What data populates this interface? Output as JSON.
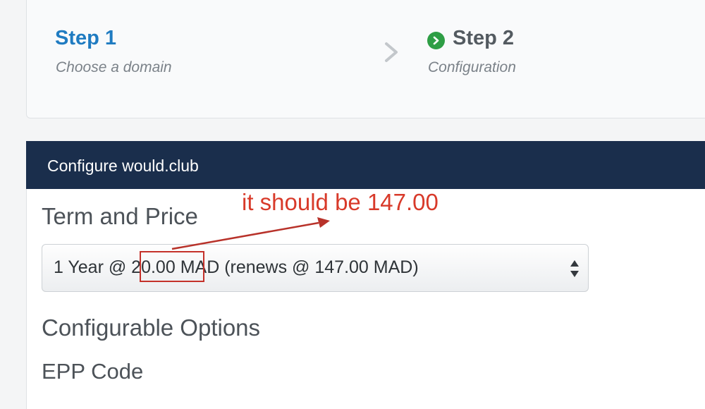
{
  "steps": [
    {
      "title": "Step 1",
      "subtitle": "Choose a domain"
    },
    {
      "title": "Step 2",
      "subtitle": "Configuration"
    }
  ],
  "icons": {
    "separator": "chevron-right-icon",
    "step2_status": "check-circle-icon"
  },
  "colors": {
    "header_bg": "#1a2e4c",
    "active_step": "#1f7bc1",
    "done_icon": "#2e9e45",
    "annotation": "#d83a2a"
  },
  "config": {
    "header": "Configure would.club",
    "term_label": "Term and Price",
    "select_value": "1 Year @ 20.00 MAD (renews @ 147.00 MAD)",
    "options_heading": "Configurable Options",
    "epp_label": "EPP Code"
  },
  "annotation": {
    "text": "it should be 147.00"
  }
}
